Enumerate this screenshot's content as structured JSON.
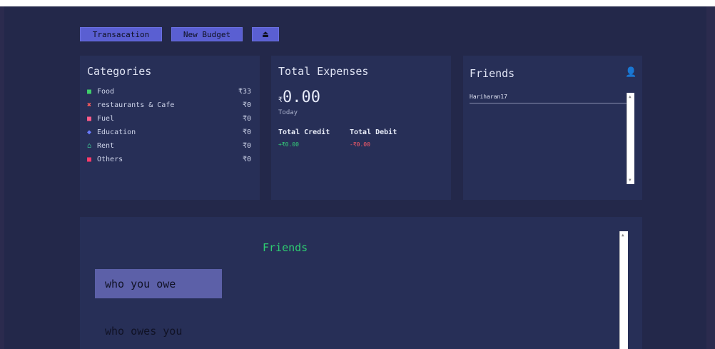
{
  "toolbar": {
    "transaction_label": "Transacation",
    "new_budget_label": "New Budget",
    "logout_icon": "⏏"
  },
  "categories": {
    "title": "Categories",
    "items": [
      {
        "icon": "food-icon",
        "glyph": "■",
        "color": "#3fcf6a",
        "label": "Food",
        "amount": "₹33"
      },
      {
        "icon": "cross-icon",
        "glyph": "✖",
        "color": "#ff5c5c",
        "label": "restaurants & Cafe",
        "amount": "₹0"
      },
      {
        "icon": "car-icon",
        "glyph": "■",
        "color": "#ff5c8a",
        "label": "Fuel",
        "amount": "₹0"
      },
      {
        "icon": "graduation-cap-icon",
        "glyph": "◆",
        "color": "#6a7bff",
        "label": "Education",
        "amount": "₹0"
      },
      {
        "icon": "home-icon",
        "glyph": "⌂",
        "color": "#3fcf9a",
        "label": "Rent",
        "amount": "₹0"
      },
      {
        "icon": "video-icon",
        "glyph": "■",
        "color": "#ff3b6a",
        "label": "Others",
        "amount": "₹0"
      }
    ]
  },
  "expenses": {
    "title": "Total Expenses",
    "currency": "₹",
    "total": "0.00",
    "period": "Today",
    "credit_label": "Total Credit",
    "debit_label": "Total Debit",
    "credit_value": "+₹0.00",
    "debit_value": "-₹0.00",
    "credit_color": "#35d07a",
    "debit_color": "#ff5c6a"
  },
  "friends_card": {
    "title": "Friends",
    "add_icon": "add-user-icon",
    "list": [
      "Hariharan17"
    ]
  },
  "bottom": {
    "title": "Friends",
    "title_color": "#2ecc71",
    "tab_owe": "who you owe",
    "tab_owes": "who owes you"
  },
  "accent": "#5a5fd2"
}
